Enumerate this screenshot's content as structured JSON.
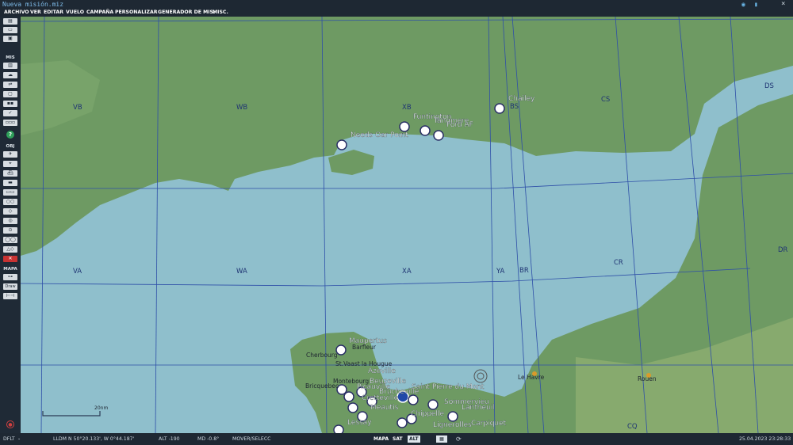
{
  "window": {
    "title": "Nueva misión.miz",
    "close_glyph": "×"
  },
  "menu": [
    "ARCHIVO",
    "VER",
    "EDITAR",
    "VUELO",
    "CAMPAÑA",
    "PERSONALIZAR",
    "GENERADOR DE MIS.",
    "MISC."
  ],
  "toolbar": {
    "section_mis": "MIS",
    "section_obj": "OBJ",
    "section_mapa": "MAPA",
    "draw_label": "Draw"
  },
  "grid_labels": [
    "VB",
    "WB",
    "XB",
    "BS",
    "CS",
    "DS",
    "VA",
    "WA",
    "XA",
    "YA",
    "BR",
    "CR",
    "DR",
    "CQ"
  ],
  "airfields": [
    "Chailey",
    "Funtington",
    "Tangmere",
    "Ford AF",
    "Needs Oar Point",
    "Maupertus",
    "Azeville",
    "Beuzeville",
    "Picauville",
    "Brucheville",
    "Cretteville",
    "Saint Pierre du Mont",
    "Lignerolles",
    "Lessay",
    "Meautis",
    "Chippelle",
    "Carpiquet",
    "Sommervieu",
    "Lantheuil"
  ],
  "towns": [
    "Barfleur",
    "Cherbourg",
    "St.Vaast la Hougue",
    "Bricquebec",
    "Le Havre",
    "Rouen",
    "Montebourg"
  ],
  "scale": {
    "label": "20nm"
  },
  "status": {
    "mode": "DFLT",
    "coords": "LLDM  N 50°20.133', W  0°44.187'",
    "alt": "ALT  -190",
    "md": "MD  -0.8°",
    "action": "MOVER/SELECC",
    "map_tabs": [
      "MAPA",
      "SAT",
      "ALT"
    ],
    "active_tab": "ALT",
    "datetime": "25.04.2023 23:28:33"
  },
  "colors": {
    "sea": "#8fbfcc",
    "land": "#6e9a63",
    "bar": "#1e2833",
    "grid": "#2e4fa8",
    "accent": "#7fbcea"
  }
}
